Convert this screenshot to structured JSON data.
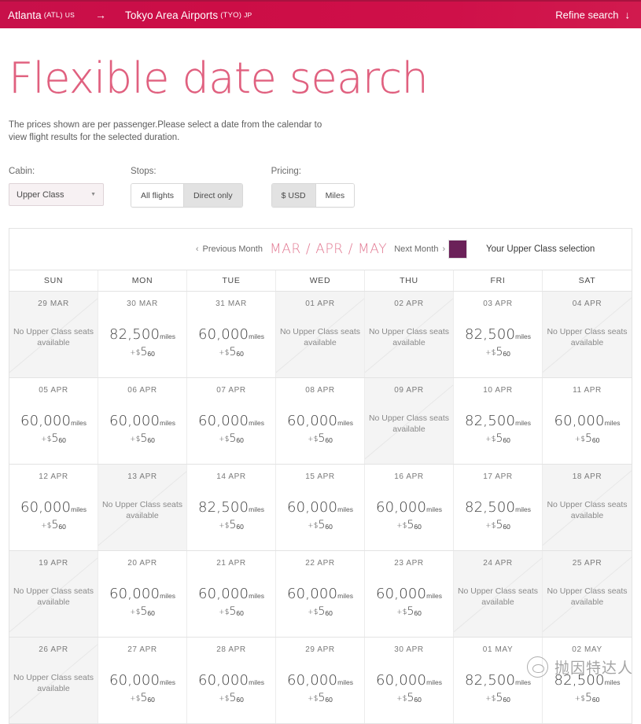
{
  "route_bar": {
    "origin_city": "Atlanta",
    "origin_code": "(ATL)",
    "origin_country": "US",
    "arrow": "→",
    "destination_city": "Tokyo Area Airports",
    "destination_code": "(TYO)",
    "destination_country": "JP",
    "refine_label": "Refine search",
    "refine_icon": "↓"
  },
  "heading": {
    "title": "Flexible date search",
    "subtitle": "The prices shown are per passenger.Please select a date from the calendar to view flight results for the selected duration."
  },
  "filters": {
    "cabin": {
      "label": "Cabin:",
      "value": "Upper Class",
      "caret": "▼"
    },
    "stops": {
      "label": "Stops:",
      "options": [
        "All flights",
        "Direct only"
      ],
      "selected": "Direct only"
    },
    "pricing": {
      "label": "Pricing:",
      "options": [
        "$ USD",
        "Miles"
      ],
      "selected": "$ USD"
    }
  },
  "calendar": {
    "prev_label": "Previous Month",
    "prev_chevron": "‹",
    "months_label": "MAR / APR / MAY",
    "next_label": "Next Month",
    "next_chevron": "›",
    "legend_text": "Your Upper Class selection",
    "legend_color": "#6b2159",
    "day_headers": [
      "SUN",
      "MON",
      "TUE",
      "WED",
      "THU",
      "FRI",
      "SAT"
    ],
    "unavailable_text": "No Upper Class seats available",
    "miles_unit": "miles",
    "tax_prefix": "+$",
    "weeks": [
      [
        {
          "date": "29 MAR",
          "available": false
        },
        {
          "date": "30 MAR",
          "available": true,
          "miles": "82,500",
          "tax_whole": "5",
          "tax_cents": "60"
        },
        {
          "date": "31 MAR",
          "available": true,
          "miles": "60,000",
          "tax_whole": "5",
          "tax_cents": "60"
        },
        {
          "date": "01 APR",
          "available": false
        },
        {
          "date": "02 APR",
          "available": false
        },
        {
          "date": "03 APR",
          "available": true,
          "miles": "82,500",
          "tax_whole": "5",
          "tax_cents": "60"
        },
        {
          "date": "04 APR",
          "available": false
        }
      ],
      [
        {
          "date": "05 APR",
          "available": true,
          "miles": "60,000",
          "tax_whole": "5",
          "tax_cents": "60"
        },
        {
          "date": "06 APR",
          "available": true,
          "miles": "60,000",
          "tax_whole": "5",
          "tax_cents": "60"
        },
        {
          "date": "07 APR",
          "available": true,
          "miles": "60,000",
          "tax_whole": "5",
          "tax_cents": "60"
        },
        {
          "date": "08 APR",
          "available": true,
          "miles": "60,000",
          "tax_whole": "5",
          "tax_cents": "60"
        },
        {
          "date": "09 APR",
          "available": false
        },
        {
          "date": "10 APR",
          "available": true,
          "miles": "82,500",
          "tax_whole": "5",
          "tax_cents": "60"
        },
        {
          "date": "11 APR",
          "available": true,
          "miles": "60,000",
          "tax_whole": "5",
          "tax_cents": "60"
        }
      ],
      [
        {
          "date": "12 APR",
          "available": true,
          "miles": "60,000",
          "tax_whole": "5",
          "tax_cents": "60"
        },
        {
          "date": "13 APR",
          "available": false
        },
        {
          "date": "14 APR",
          "available": true,
          "miles": "82,500",
          "tax_whole": "5",
          "tax_cents": "60"
        },
        {
          "date": "15 APR",
          "available": true,
          "miles": "60,000",
          "tax_whole": "5",
          "tax_cents": "60"
        },
        {
          "date": "16 APR",
          "available": true,
          "miles": "60,000",
          "tax_whole": "5",
          "tax_cents": "60"
        },
        {
          "date": "17 APR",
          "available": true,
          "miles": "82,500",
          "tax_whole": "5",
          "tax_cents": "60"
        },
        {
          "date": "18 APR",
          "available": false
        }
      ],
      [
        {
          "date": "19 APR",
          "available": false
        },
        {
          "date": "20 APR",
          "available": true,
          "miles": "60,000",
          "tax_whole": "5",
          "tax_cents": "60"
        },
        {
          "date": "21 APR",
          "available": true,
          "miles": "60,000",
          "tax_whole": "5",
          "tax_cents": "60"
        },
        {
          "date": "22 APR",
          "available": true,
          "miles": "60,000",
          "tax_whole": "5",
          "tax_cents": "60"
        },
        {
          "date": "23 APR",
          "available": true,
          "miles": "60,000",
          "tax_whole": "5",
          "tax_cents": "60"
        },
        {
          "date": "24 APR",
          "available": false
        },
        {
          "date": "25 APR",
          "available": false
        }
      ],
      [
        {
          "date": "26 APR",
          "available": false
        },
        {
          "date": "27 APR",
          "available": true,
          "miles": "60,000",
          "tax_whole": "5",
          "tax_cents": "60"
        },
        {
          "date": "28 APR",
          "available": true,
          "miles": "60,000",
          "tax_whole": "5",
          "tax_cents": "60"
        },
        {
          "date": "29 APR",
          "available": true,
          "miles": "60,000",
          "tax_whole": "5",
          "tax_cents": "60"
        },
        {
          "date": "30 APR",
          "available": true,
          "miles": "60,000",
          "tax_whole": "5",
          "tax_cents": "60"
        },
        {
          "date": "01 MAY",
          "available": true,
          "miles": "82,500",
          "tax_whole": "5",
          "tax_cents": "60"
        },
        {
          "date": "02 MAY",
          "available": true,
          "miles": "82,500",
          "tax_whole": "5",
          "tax_cents": "60"
        }
      ]
    ]
  },
  "watermark": {
    "text": "抛因特达人"
  }
}
